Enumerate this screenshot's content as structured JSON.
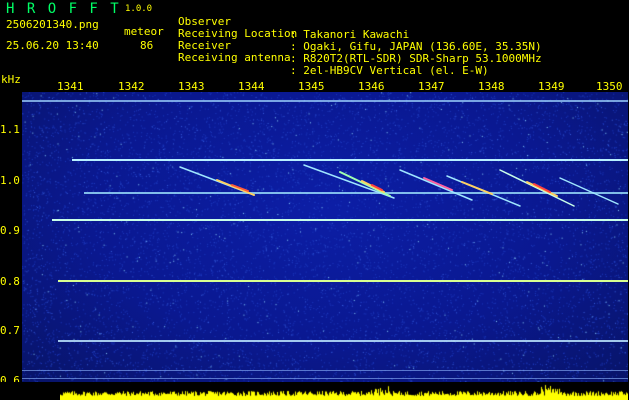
{
  "app": {
    "name": "H R O F F T",
    "version": "1.0.0"
  },
  "capture": {
    "filename": "2506201340.png",
    "timestamp": "25.06.20 13:40",
    "type_label": "meteor",
    "count": "86"
  },
  "info": [
    {
      "label": "Observer",
      "value": ": Takanori Kawachi"
    },
    {
      "label": "Receiving Location",
      "value": ": Ogaki, Gifu, JAPAN (136.60E, 35.35N)"
    },
    {
      "label": "Receiver",
      "value": ": R820T2(RTL-SDR) SDR-Sharp 53.1000MHz"
    },
    {
      "label": "Receiving antenna",
      "value": ": 2el-HB9CV Vertical (el. E-W)"
    }
  ],
  "axes": {
    "y_unit": "kHz",
    "x_ticks": [
      "1341",
      "1342",
      "1343",
      "1344",
      "1345",
      "1346",
      "1347",
      "1348",
      "1349",
      "1350"
    ],
    "y_ticks": [
      "1.1",
      "1.0",
      "0.9",
      "0.8",
      "0.7",
      "0.6"
    ]
  },
  "colors": {
    "background": "#000000",
    "plot_bg": "#0a1890",
    "label": "#ffff00",
    "title": "#00ff66",
    "line": "#aee8ff",
    "activity": "#ffff00"
  }
}
